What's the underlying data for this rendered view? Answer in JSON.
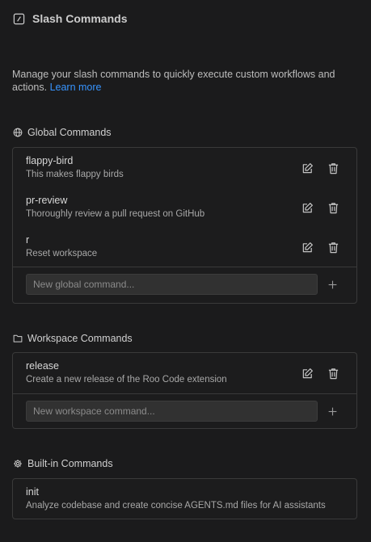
{
  "header": {
    "title": "Slash Commands"
  },
  "description": {
    "text": "Manage your slash commands to quickly execute custom workflows and actions. ",
    "link": "Learn more"
  },
  "global": {
    "title": "Global Commands",
    "commands": [
      {
        "name": "flappy-bird",
        "desc": "This makes flappy birds"
      },
      {
        "name": "pr-review",
        "desc": "Thoroughly review a pull request on GitHub"
      },
      {
        "name": "r",
        "desc": "Reset workspace"
      }
    ],
    "placeholder": "New global command..."
  },
  "workspace": {
    "title": "Workspace Commands",
    "commands": [
      {
        "name": "release",
        "desc": "Create a new release of the Roo Code extension"
      }
    ],
    "placeholder": "New workspace command..."
  },
  "builtin": {
    "title": "Built-in Commands",
    "commands": [
      {
        "name": "init",
        "desc": "Analyze codebase and create concise AGENTS.md files for AI assistants"
      }
    ]
  },
  "icons": {
    "header": "slash-square-icon",
    "global": "globe-icon",
    "workspace": "folder-icon",
    "builtin": "gear-icon",
    "edit": "edit-icon",
    "delete": "trash-icon",
    "add": "plus-icon"
  },
  "colors": {
    "background": "#1b1b1c",
    "link": "#3794ff",
    "border": "#3a3a3a"
  }
}
